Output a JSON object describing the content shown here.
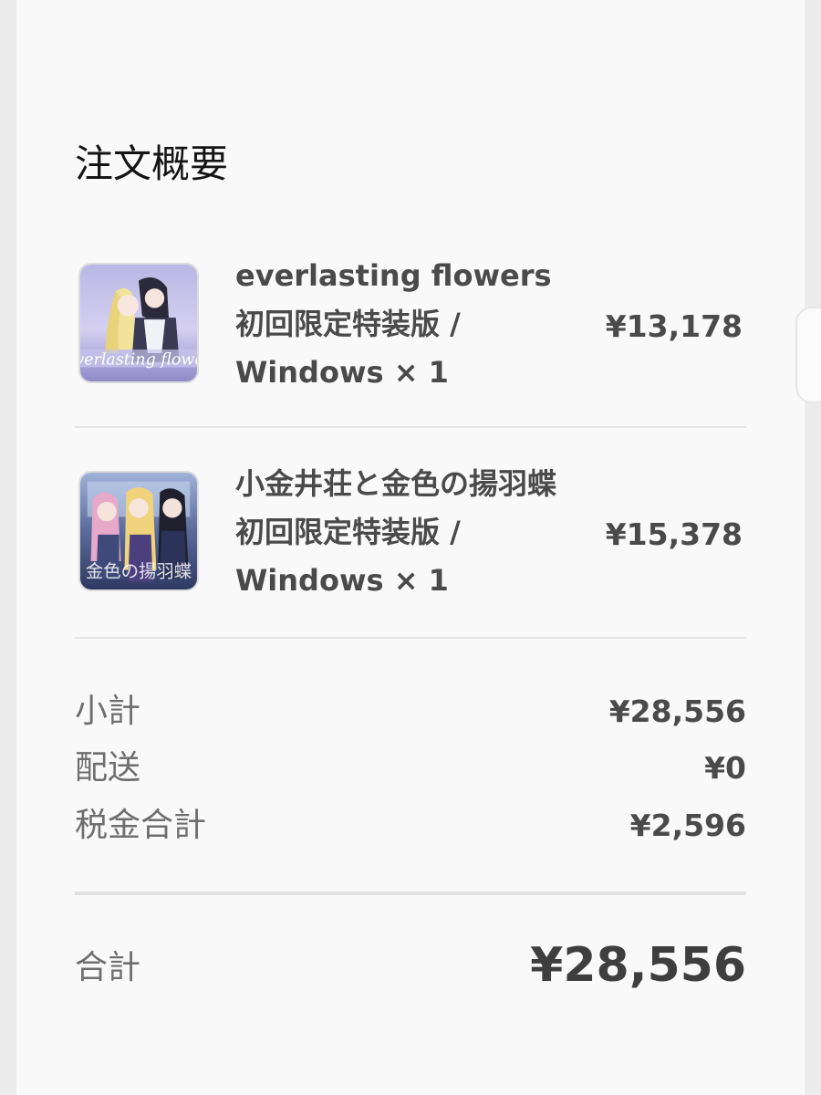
{
  "order_summary": {
    "title": "注文概要",
    "items": [
      {
        "name": "everlasting flowers 初回限定特装版 / Windows × 1",
        "price": "¥13,178",
        "thumbnail_icon": "everlasting-flowers-cover-image",
        "cover_text": "everlasting flower"
      },
      {
        "name": "小金井荘と金色の揚羽蝶 初回限定特装版 / Windows × 1",
        "price": "¥15,378",
        "thumbnail_icon": "koganei-so-cover-image",
        "cover_text": "金色の揚羽蝶"
      }
    ],
    "summary": {
      "subtotal_label": "小計",
      "subtotal_value": "¥28,556",
      "shipping_label": "配送",
      "shipping_value": "¥0",
      "tax_label": "税金合計",
      "tax_value": "¥2,596"
    },
    "total": {
      "label": "合計",
      "value": "¥28,556"
    }
  },
  "colors": {
    "page_background": "#f9f9f9",
    "title_text": "#141414",
    "body_text": "#4a4a4a",
    "muted_text": "#6e6e6e",
    "divider": "#e4e4e4"
  }
}
